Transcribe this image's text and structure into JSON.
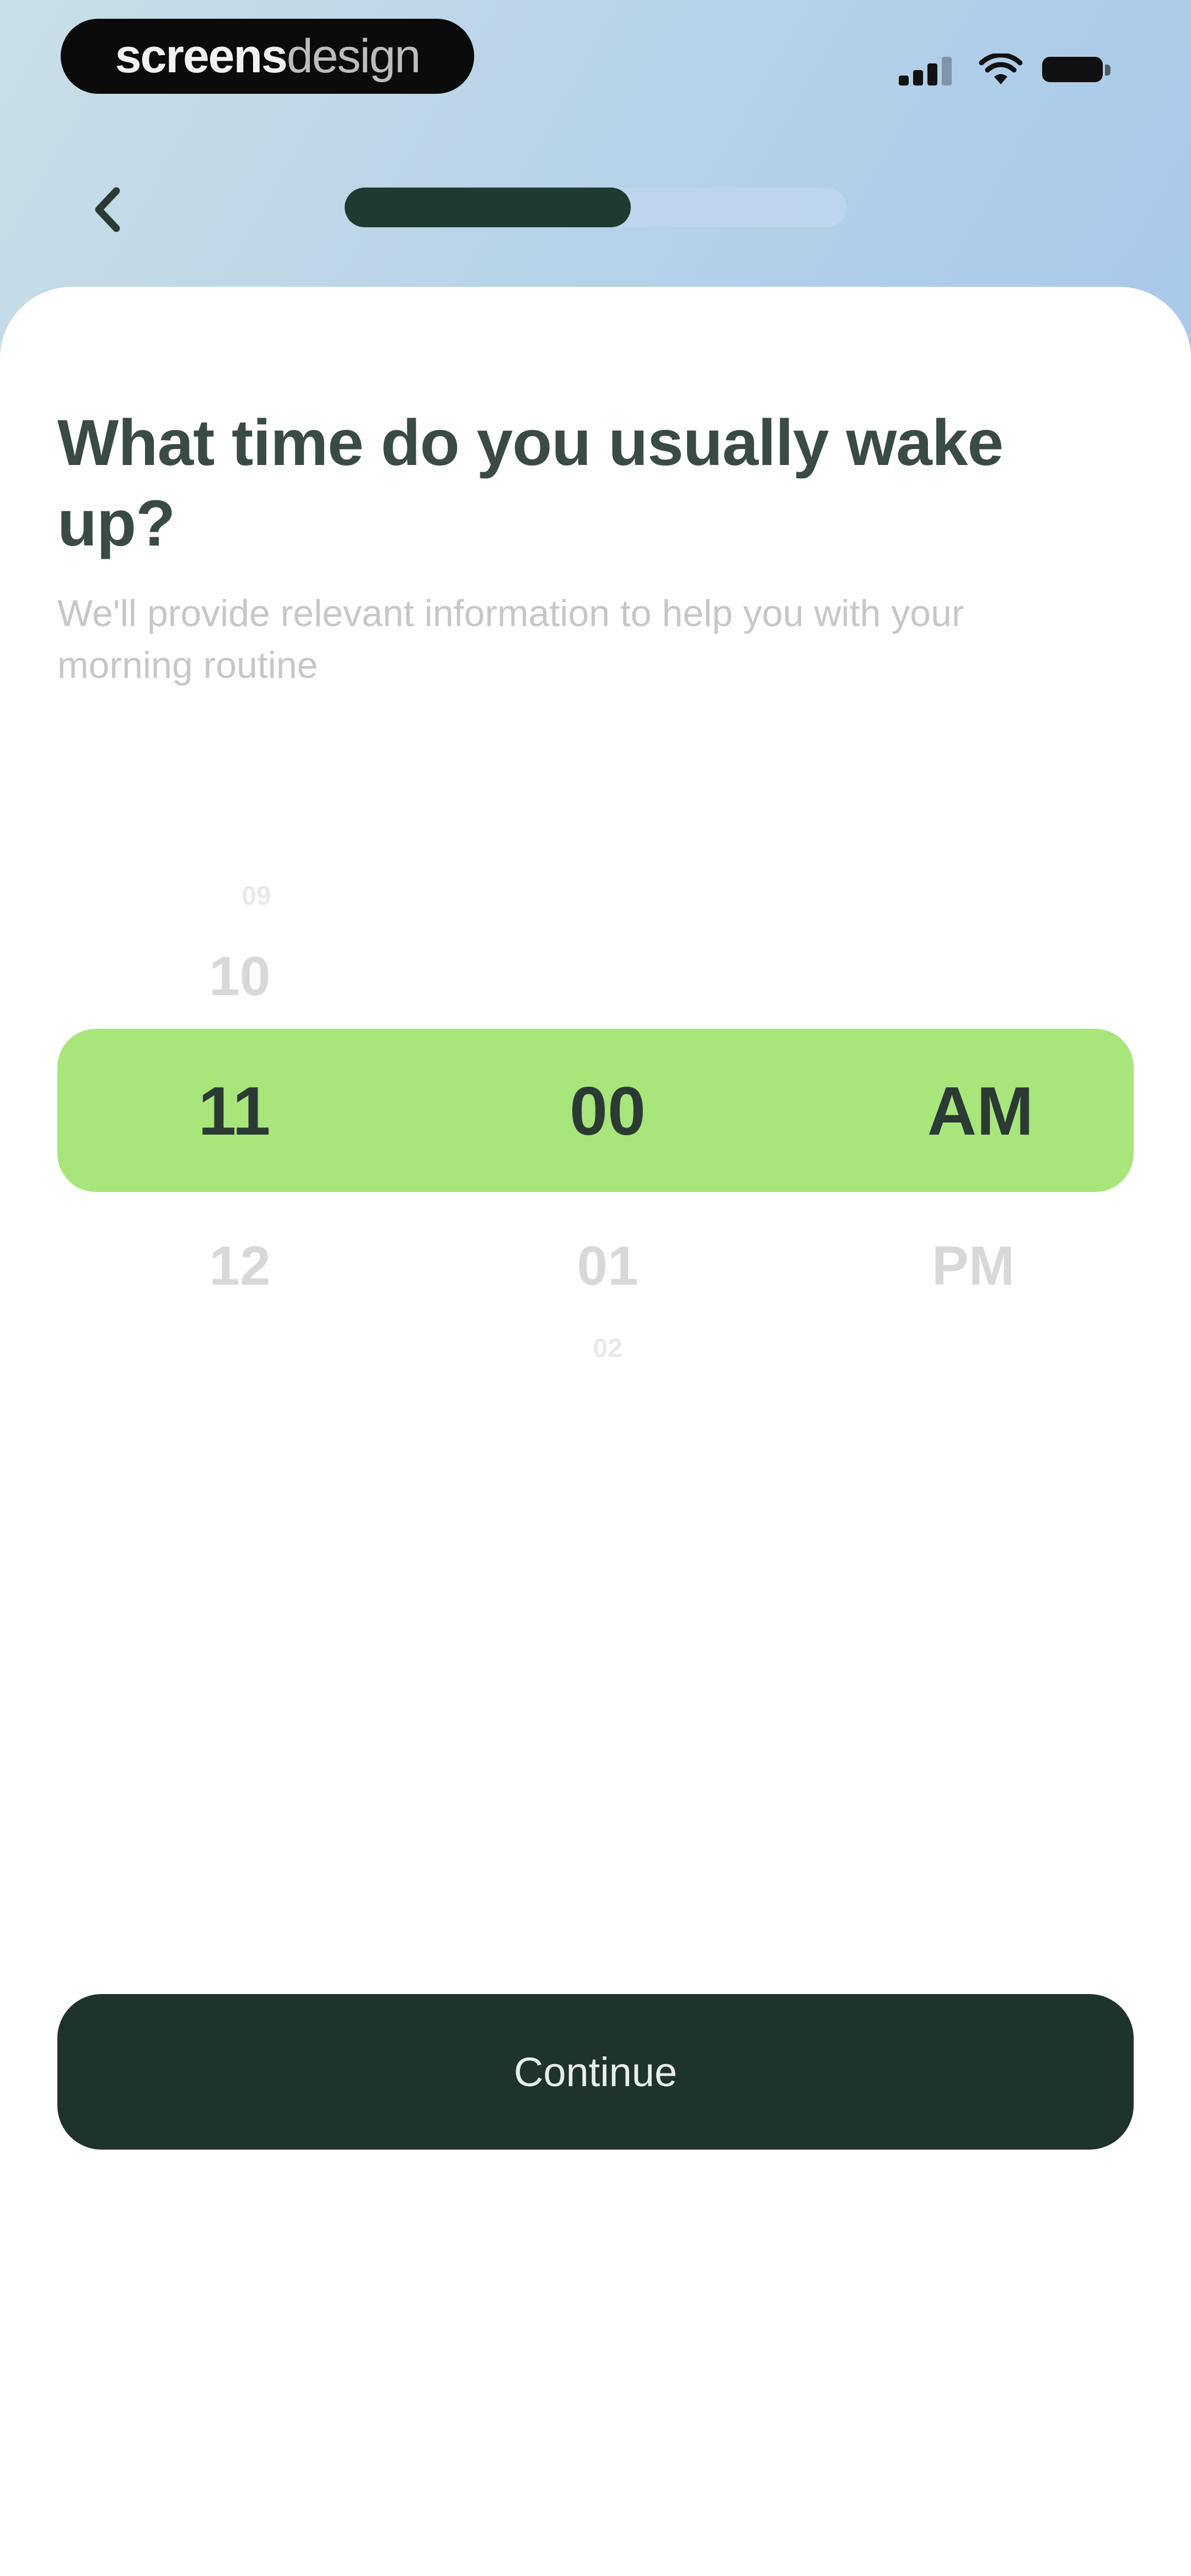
{
  "status_bar": {
    "brand_bold": "screens",
    "brand_light": "design",
    "signal_icon": "cellular-signal-icon",
    "wifi_icon": "wifi-icon",
    "battery_icon": "battery-icon"
  },
  "nav": {
    "back_icon": "chevron-left-icon",
    "progress": 0.57
  },
  "question": {
    "title": "What time do you usually wake up?",
    "subtitle": "We'll provide relevant information to help you with your morning routine"
  },
  "picker": {
    "hours": {
      "far_above": "09",
      "above": "10",
      "selected": "11",
      "below": "12"
    },
    "minutes": {
      "selected": "00",
      "below": "01",
      "far_below": "02"
    },
    "period": {
      "selected": "AM",
      "below": "PM"
    }
  },
  "footer": {
    "continue_label": "Continue"
  },
  "colors": {
    "accent_green": "#a8e67c",
    "dark_green": "#1e332b",
    "title_text": "#3a4a44"
  }
}
